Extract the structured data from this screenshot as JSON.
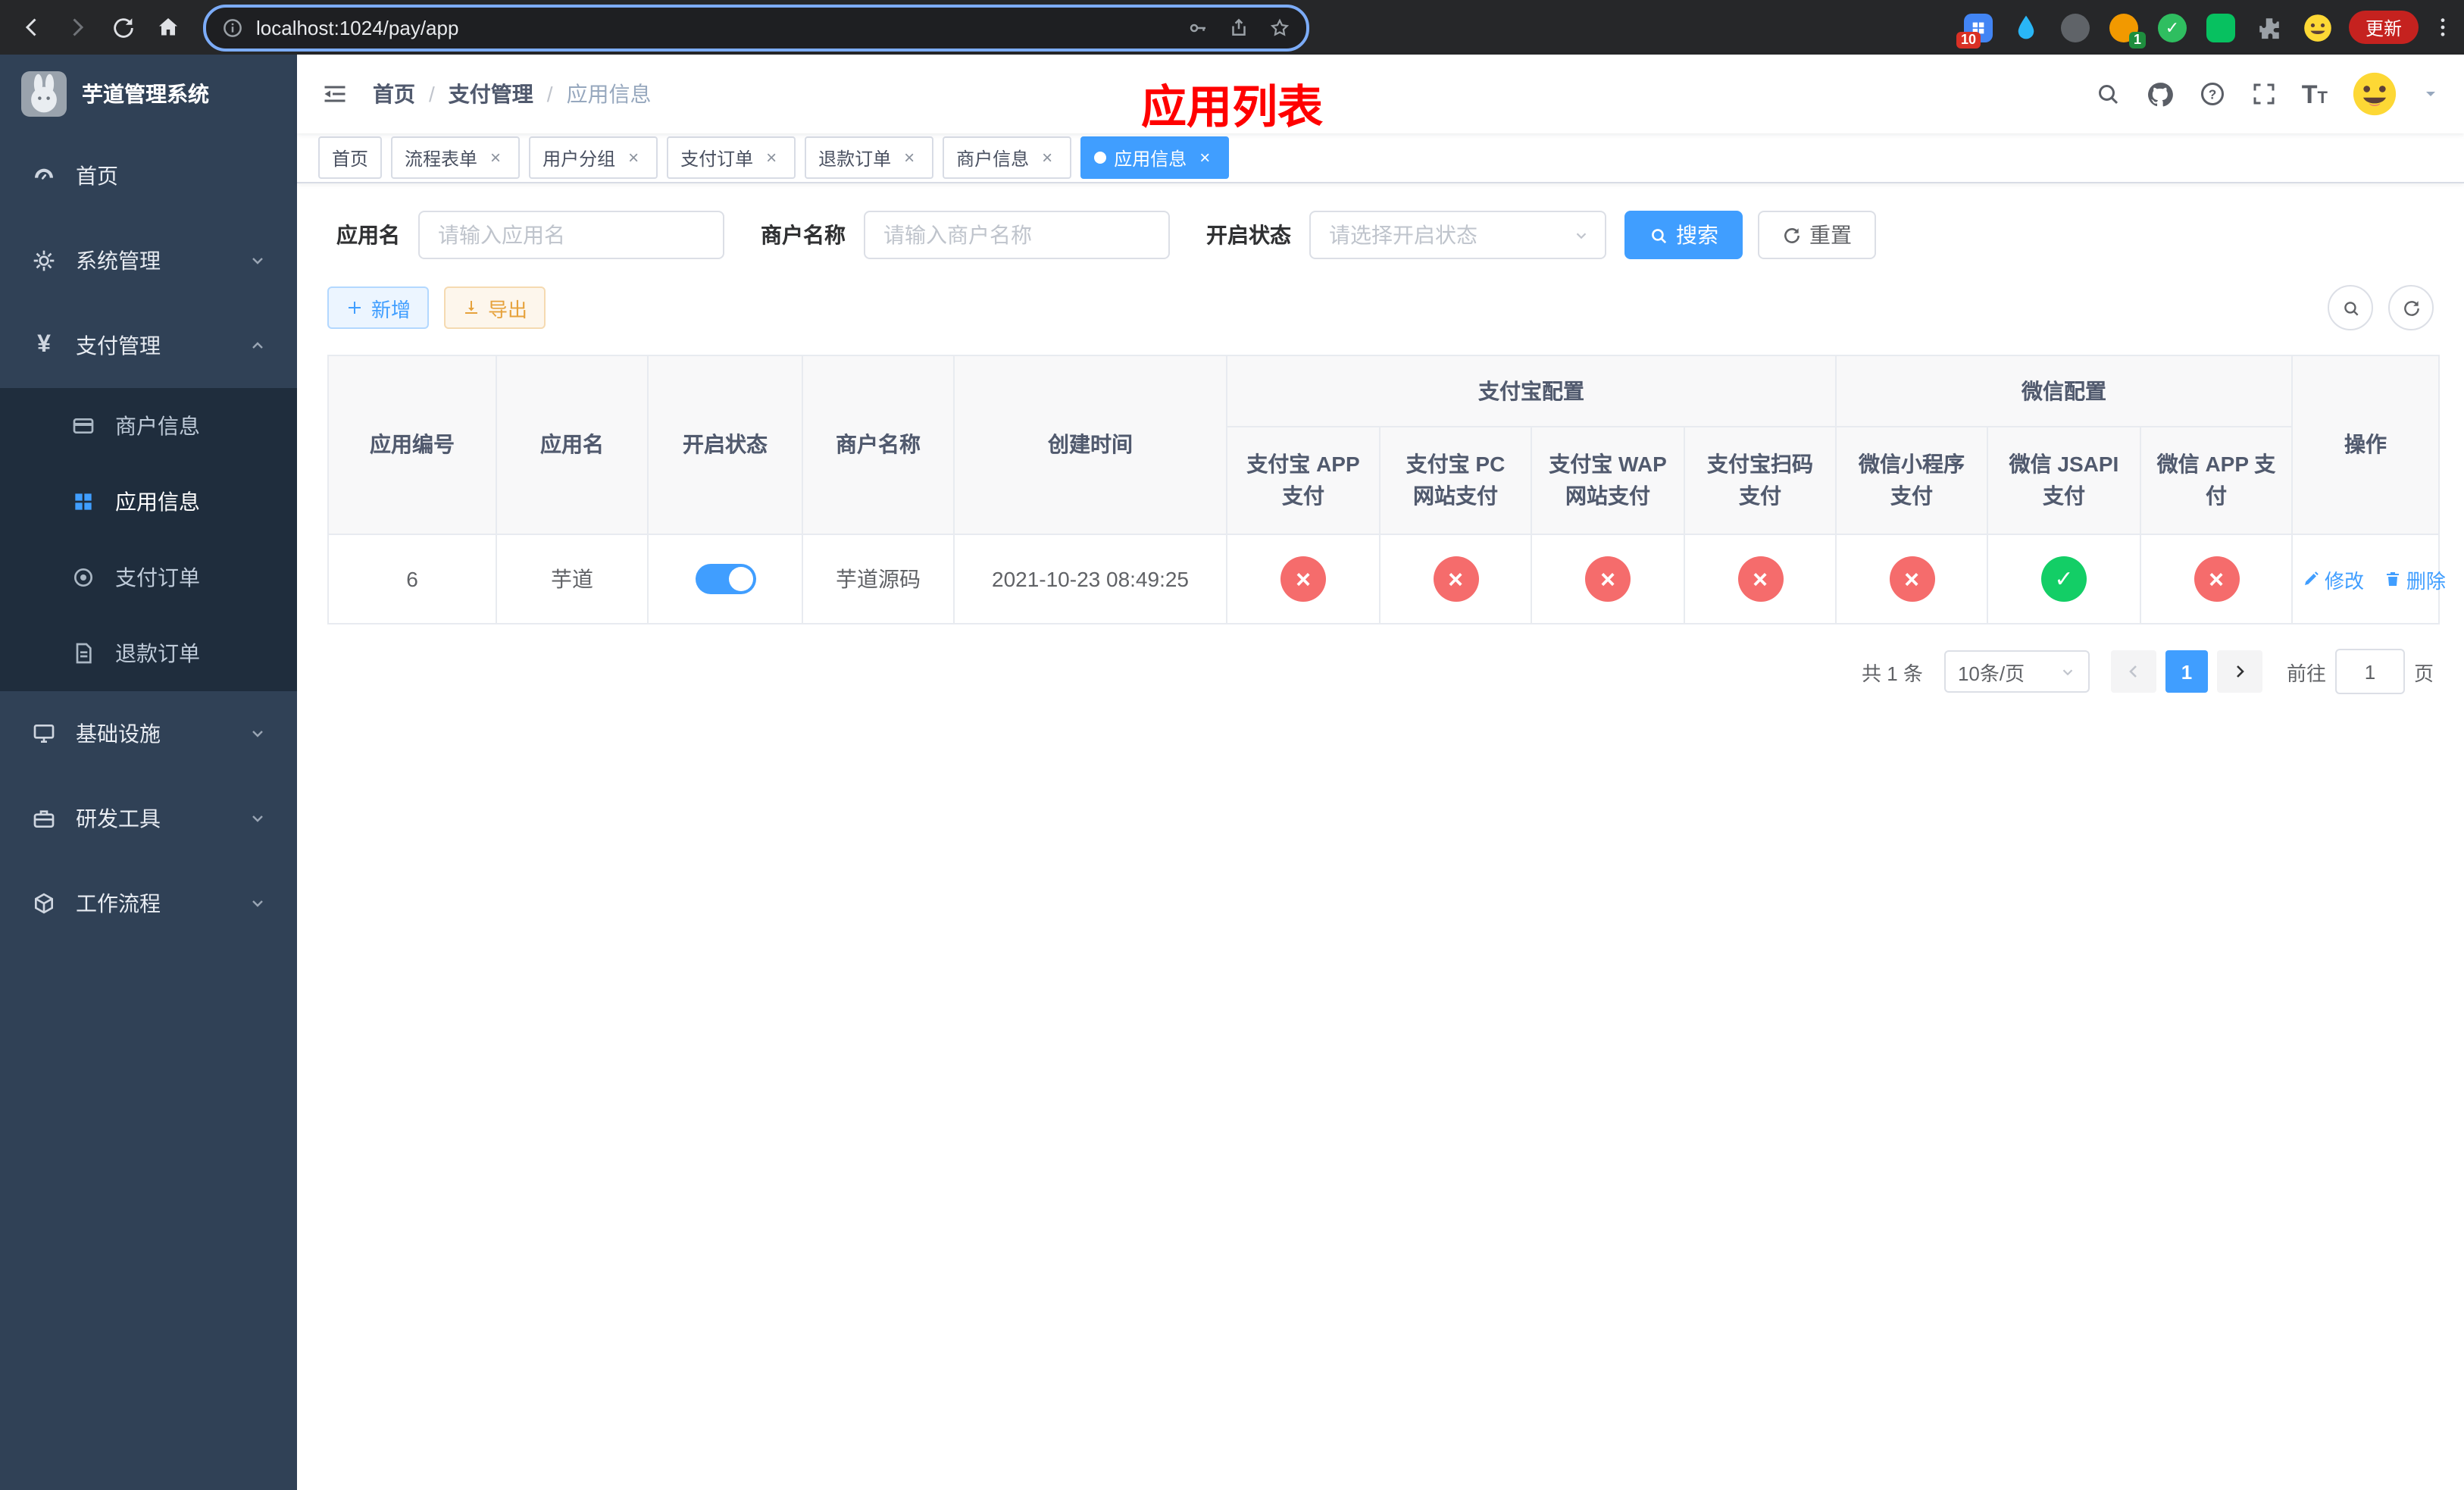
{
  "colors": {
    "accent": "#409EFF",
    "danger": "#F56C6C",
    "success": "#13CE66",
    "warning": "#E6A23C",
    "title": "#FF0000"
  },
  "browser": {
    "url": "localhost:1024/pay/app",
    "update_label": "更新",
    "ext_badge_grid": "10",
    "ext_badge_one": "1"
  },
  "sidebar": {
    "logo_title": "芋道管理系统",
    "items": {
      "home": "首页",
      "system": "系统管理",
      "pay": "支付管理",
      "infra": "基础设施",
      "dev": "研发工具",
      "workflow": "工作流程"
    },
    "pay_children": {
      "merchant": "商户信息",
      "app": "应用信息",
      "order": "支付订单",
      "refund": "退款订单"
    }
  },
  "navbar": {
    "breadcrumb": {
      "home": "首页",
      "pay": "支付管理",
      "current": "应用信息"
    },
    "page_title": "应用列表"
  },
  "tabs": [
    {
      "label": "首页"
    },
    {
      "label": "流程表单"
    },
    {
      "label": "用户分组"
    },
    {
      "label": "支付订单"
    },
    {
      "label": "退款订单"
    },
    {
      "label": "商户信息"
    },
    {
      "label": "应用信息"
    }
  ],
  "filters": {
    "app_name_label": "应用名",
    "app_name_placeholder": "请输入应用名",
    "merchant_label": "商户名称",
    "merchant_placeholder": "请输入商户名称",
    "status_label": "开启状态",
    "status_placeholder": "请选择开启状态",
    "search_label": "搜索",
    "reset_label": "重置"
  },
  "toolbar": {
    "add_label": "新增",
    "export_label": "导出"
  },
  "table": {
    "col_app_id": "应用编号",
    "col_app_name": "应用名",
    "col_status": "开启状态",
    "col_merchant": "商户名称",
    "col_created": "创建时间",
    "group_alipay": "支付宝配置",
    "group_wechat": "微信配置",
    "col_alipay_app": "支付宝 APP 支付",
    "col_alipay_pc": "支付宝 PC 网站支付",
    "col_alipay_wap": "支付宝 WAP 网站支付",
    "col_alipay_qr": "支付宝扫码支付",
    "col_wechat_mini": "微信小程序支付",
    "col_wechat_jsapi": "微信 JSAPI 支付",
    "col_wechat_app": "微信 APP 支付",
    "col_actions": "操作",
    "row": {
      "app_id": "6",
      "app_name": "芋道",
      "status": "on",
      "merchant": "芋道源码",
      "created": "2021-10-23 08:49:25",
      "alipay_app": "fail",
      "alipay_pc": "fail",
      "alipay_wap": "fail",
      "alipay_qr": "fail",
      "wechat_mini": "fail",
      "wechat_jsapi": "ok",
      "wechat_app": "fail",
      "edit_label": "修改",
      "delete_label": "删除"
    }
  },
  "pagination": {
    "total": "共 1 条",
    "page_size": "10条/页",
    "current_page": "1",
    "goto_label": "前往",
    "goto_value": "1",
    "page_unit": "页"
  }
}
